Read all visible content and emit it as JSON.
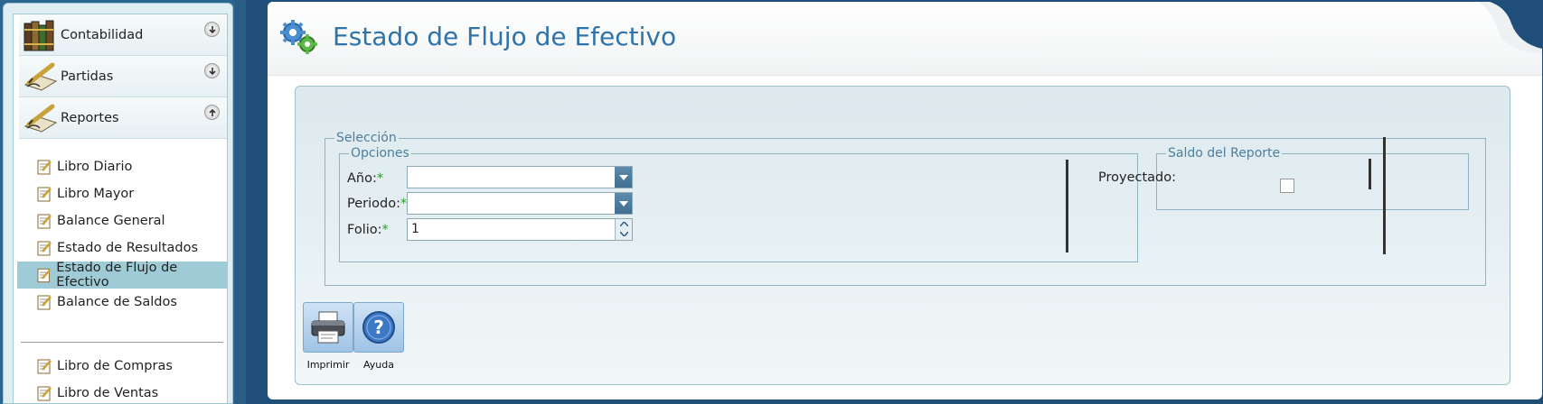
{
  "sidebar": {
    "sections": [
      {
        "label": "Contabilidad",
        "icon": "books-icon",
        "state": "collapsed"
      },
      {
        "label": "Partidas",
        "icon": "pen-paper-icon",
        "state": "collapsed"
      },
      {
        "label": "Reportes",
        "icon": "pen-paper-icon",
        "state": "expanded"
      }
    ],
    "items": [
      {
        "label": "Libro Diario"
      },
      {
        "label": "Libro Mayor"
      },
      {
        "label": "Balance General"
      },
      {
        "label": "Estado de Resultados"
      },
      {
        "label": "Estado de Flujo de Efectivo",
        "selected": true
      },
      {
        "label": "Balance de Saldos"
      },
      {
        "label": "Libro de Compras"
      },
      {
        "label": "Libro de Ventas"
      }
    ]
  },
  "page": {
    "title": "Estado de Flujo de Efectivo"
  },
  "form": {
    "seleccion_legend": "Selección",
    "opciones_legend": "Opciones",
    "saldo_legend": "Saldo del Reporte",
    "anio_label": "Año:",
    "periodo_label": "Periodo:",
    "folio_label": "Folio:",
    "required_mark": "*",
    "anio_value": "",
    "periodo_value": "",
    "folio_value": "1",
    "proyectado_label": "Proyectado:",
    "proyectado_checked": false
  },
  "toolbar": {
    "print_label": "Imprimir",
    "help_label": "Ayuda"
  },
  "colors": {
    "title": "#2f73a8",
    "background": "#1f4f78",
    "selected_item": "#9fcbd6",
    "required": "#2a9a2a"
  }
}
